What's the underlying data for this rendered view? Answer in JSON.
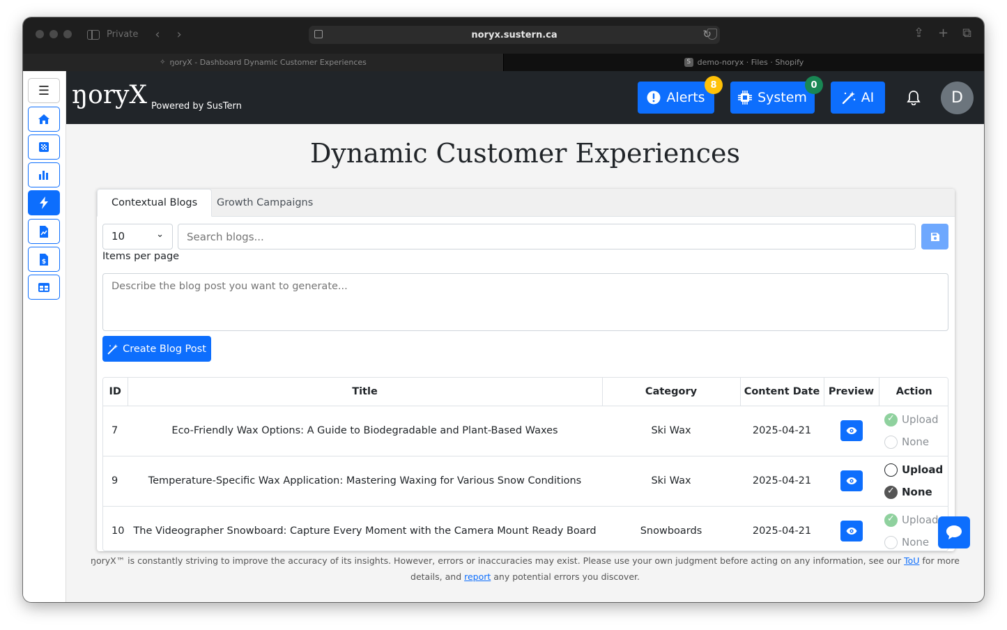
{
  "browser": {
    "private_label": "Private",
    "url": "noryx.sustern.ca",
    "tabs": [
      {
        "title": "ŋoryX - Dashboard Dynamic Customer Experiences",
        "favicon": ""
      },
      {
        "title": "demo-noryx · Files · Shopify",
        "favicon": "S"
      }
    ]
  },
  "header": {
    "logo": "ŋoryX",
    "powered_by": "Powered by SusTern",
    "alerts_label": "Alerts",
    "alerts_count": "8",
    "system_label": "System",
    "system_count": "0",
    "ai_label": "AI",
    "avatar_initial": "D"
  },
  "page": {
    "title": "Dynamic Customer Experiences",
    "tabs": [
      {
        "label": "Contextual Blogs",
        "active": true
      },
      {
        "label": "Growth Campaigns",
        "active": false
      }
    ],
    "items_per_page_value": "10",
    "items_per_page_label": "Items per page",
    "search_placeholder": "Search blogs...",
    "prompt_placeholder": "Describe the blog post you want to generate...",
    "create_button": "Create Blog Post"
  },
  "table": {
    "columns": [
      "ID",
      "Title",
      "Category",
      "Content Date",
      "Preview",
      "Action"
    ],
    "rows": [
      {
        "id": "7",
        "title": "Eco-Friendly Wax Options: A Guide to Biodegradable and Plant-Based Waxes",
        "category": "Ski Wax",
        "date": "2025-04-21",
        "upload": "Upload",
        "none": "None",
        "selected": "upload",
        "enabled": false
      },
      {
        "id": "9",
        "title": "Temperature-Specific Wax Application: Mastering Waxing for Various Snow Conditions",
        "category": "Ski Wax",
        "date": "2025-04-21",
        "upload": "Upload",
        "none": "None",
        "selected": "none",
        "enabled": true
      },
      {
        "id": "10",
        "title": "The Videographer Snowboard: Capture Every Moment with the Camera Mount Ready Board",
        "category": "Snowboards",
        "date": "2025-04-21",
        "upload": "Upload",
        "none": "None",
        "selected": "upload",
        "enabled": false
      }
    ]
  },
  "footer": {
    "text_1": "ŋoryX™ is constantly striving to improve the accuracy of its insights. However, errors or inaccuracies may exist. Please use your own judgment before acting on any information, see our ",
    "tou_link": "ToU",
    "text_2": " for more details, and ",
    "report_link": "report",
    "text_3": " any potential errors you discover."
  },
  "colors": {
    "primary": "#0d6efd",
    "header_bg": "#212529",
    "alerts_badge": "#ffc107",
    "system_badge": "#198754",
    "radio_checked_disabled": "#8fd19e"
  },
  "icons": {
    "sidebar": [
      "menu-icon",
      "home-icon",
      "grid-icon",
      "bar-chart-icon",
      "lightning-icon",
      "document-chart-icon",
      "invoice-icon",
      "table-icon"
    ],
    "alerts": "exclamation-circle-icon",
    "system": "cpu-icon",
    "ai": "magic-wand-icon",
    "notifications": "bell-icon",
    "save": "floppy-disk-icon",
    "preview": "eye-icon",
    "chat": "chat-bubble-icon"
  }
}
